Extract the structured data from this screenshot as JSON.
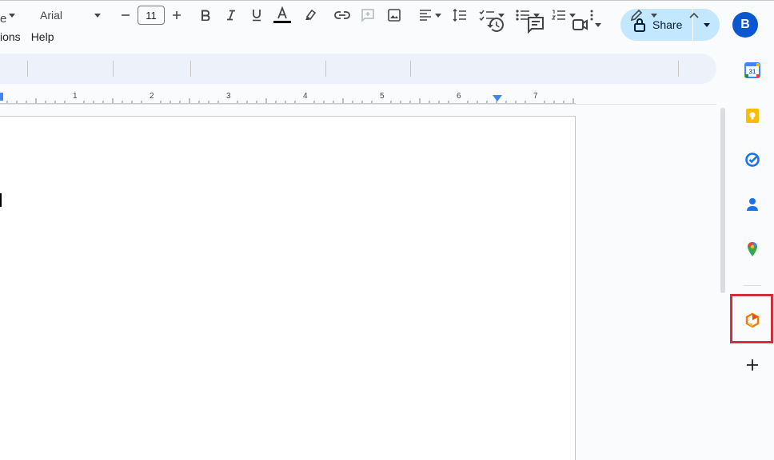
{
  "doc": {
    "title_fragment": "e"
  },
  "menu": {
    "items": [
      "ions",
      "Help"
    ]
  },
  "header": {
    "share_label": "Share",
    "avatar_letter": "B"
  },
  "toolbar": {
    "font_name": "Arial",
    "font_size": "11"
  },
  "ruler": {
    "numbers": [
      "1",
      "2",
      "3",
      "4",
      "5",
      "6",
      "7"
    ]
  },
  "side_panel": {
    "calendar_day": "31"
  },
  "colors": {
    "share_bg": "#c2e7ff",
    "avatar_bg": "#0b57d0",
    "highlight": "#d32f3a",
    "toolbar_bg": "#edf2fa"
  }
}
